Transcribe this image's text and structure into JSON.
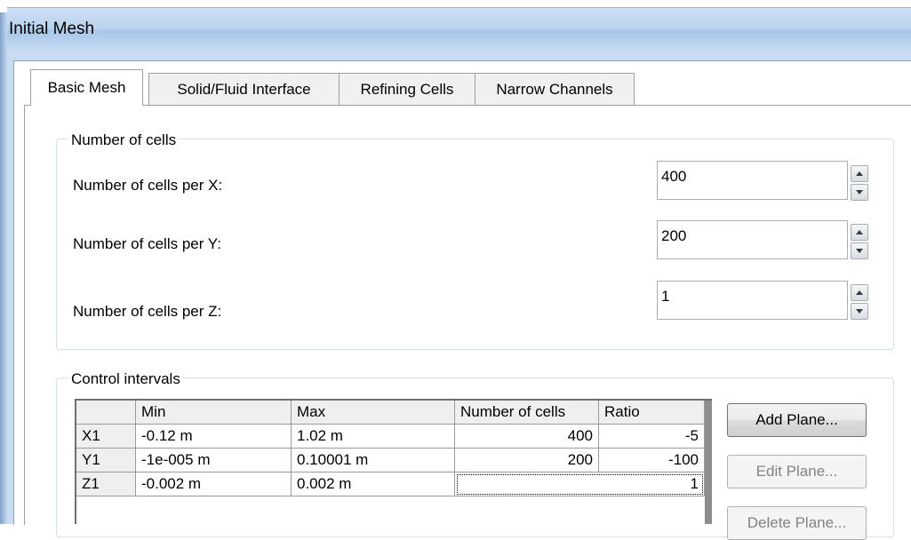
{
  "window": {
    "title": "Initial Mesh"
  },
  "tabs": [
    {
      "label": "Basic Mesh",
      "active": true
    },
    {
      "label": "Solid/Fluid Interface",
      "active": false
    },
    {
      "label": "Refining Cells",
      "active": false
    },
    {
      "label": "Narrow Channels",
      "active": false
    }
  ],
  "number_of_cells": {
    "group_label": "Number of cells",
    "rows": [
      {
        "label": "Number of cells per X:",
        "value": "400"
      },
      {
        "label": "Number of cells per Y:",
        "value": "200"
      },
      {
        "label": "Number of cells per Z:",
        "value": "1"
      }
    ]
  },
  "control_intervals": {
    "group_label": "Control intervals",
    "columns": [
      "",
      "Min",
      "Max",
      "Number of cells",
      "Ratio"
    ],
    "rows": [
      {
        "name": "X1",
        "min": "-0.12 m",
        "max": "1.02 m",
        "cells": "400",
        "ratio": "-5"
      },
      {
        "name": "Y1",
        "min": "-1e-005 m",
        "max": "0.10001 m",
        "cells": "200",
        "ratio": "-100"
      },
      {
        "name": "Z1",
        "min": "-0.002 m",
        "max": "0.002 m",
        "cells": "",
        "ratio": "1"
      }
    ],
    "buttons": {
      "add_plane": "Add Plane...",
      "edit_plane": "Edit Plane...",
      "delete_plane": "Delete Plane..."
    }
  }
}
